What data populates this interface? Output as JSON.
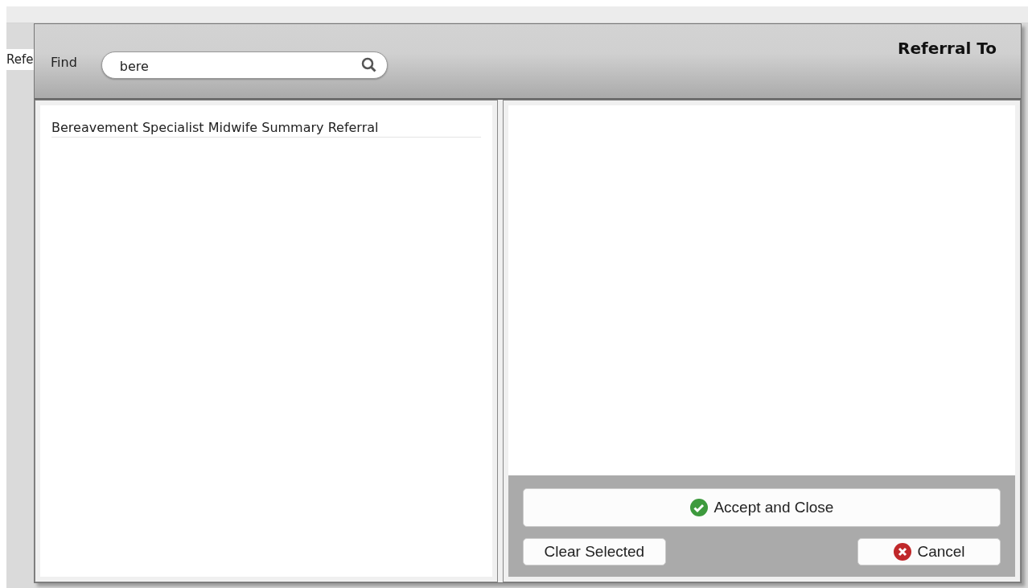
{
  "background_tab": {
    "label": "Refe"
  },
  "dialog": {
    "title": "Referral To",
    "find_label": "Find",
    "search": {
      "value": "bere"
    }
  },
  "results": [
    {
      "label": "Bereavement Specialist Midwife Summary Referral",
      "selected": false
    }
  ],
  "buttons": [
    {
      "kind": "accept",
      "label": "Accept and Close"
    },
    {
      "kind": "clear",
      "label": "Clear Selected"
    },
    {
      "kind": "cancel",
      "label": "Cancel"
    }
  ]
}
